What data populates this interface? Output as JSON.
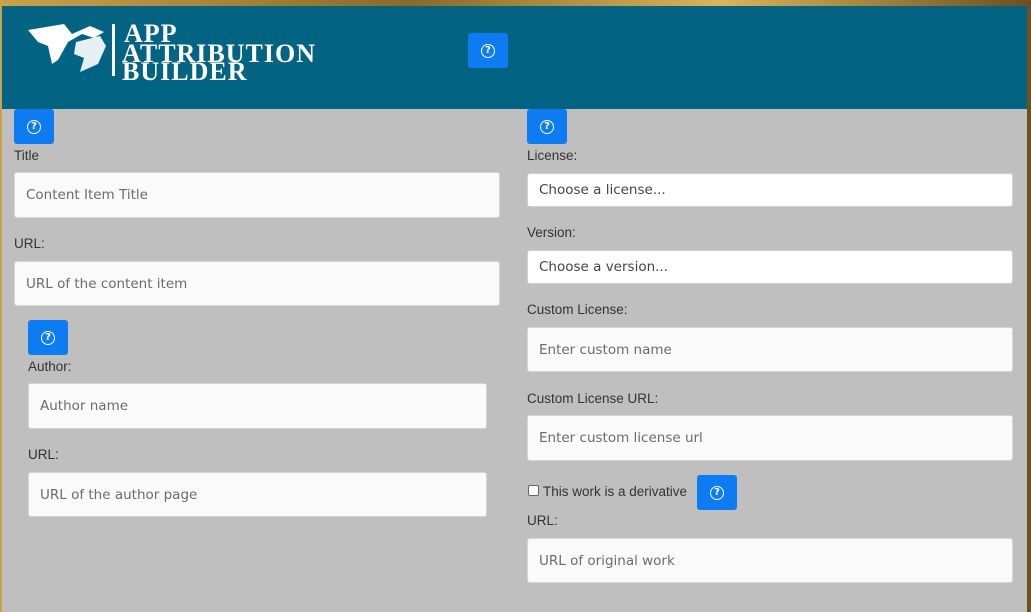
{
  "header": {
    "logo_line1": "APP",
    "logo_line2": "ATTRIBUTION",
    "logo_line3": "BUILDER",
    "bg_color": "#036383",
    "help_icon": "question-circle-icon"
  },
  "left": {
    "title_label": "Title",
    "title_placeholder": "Content Item Title",
    "url_label": "URL:",
    "url_placeholder": "URL of the content item",
    "author_label": "Author:",
    "author_placeholder": "Author name",
    "author_url_label": "URL:",
    "author_url_placeholder": "URL of the author page"
  },
  "right": {
    "license_label": "License:",
    "license_selected": "Choose a license...",
    "version_label": "Version:",
    "version_selected": "Choose a version...",
    "custom_license_label": "Custom License:",
    "custom_license_placeholder": "Enter custom name",
    "custom_license_url_label": "Custom License URL:",
    "custom_license_url_placeholder": "Enter custom license url",
    "derivative_label": "This work is a derivative",
    "derivative_checked": false,
    "original_url_label": "URL:",
    "original_url_placeholder": "URL of original work"
  },
  "colors": {
    "accent": "#0d7cf2",
    "panel": "#bfbfbf"
  }
}
